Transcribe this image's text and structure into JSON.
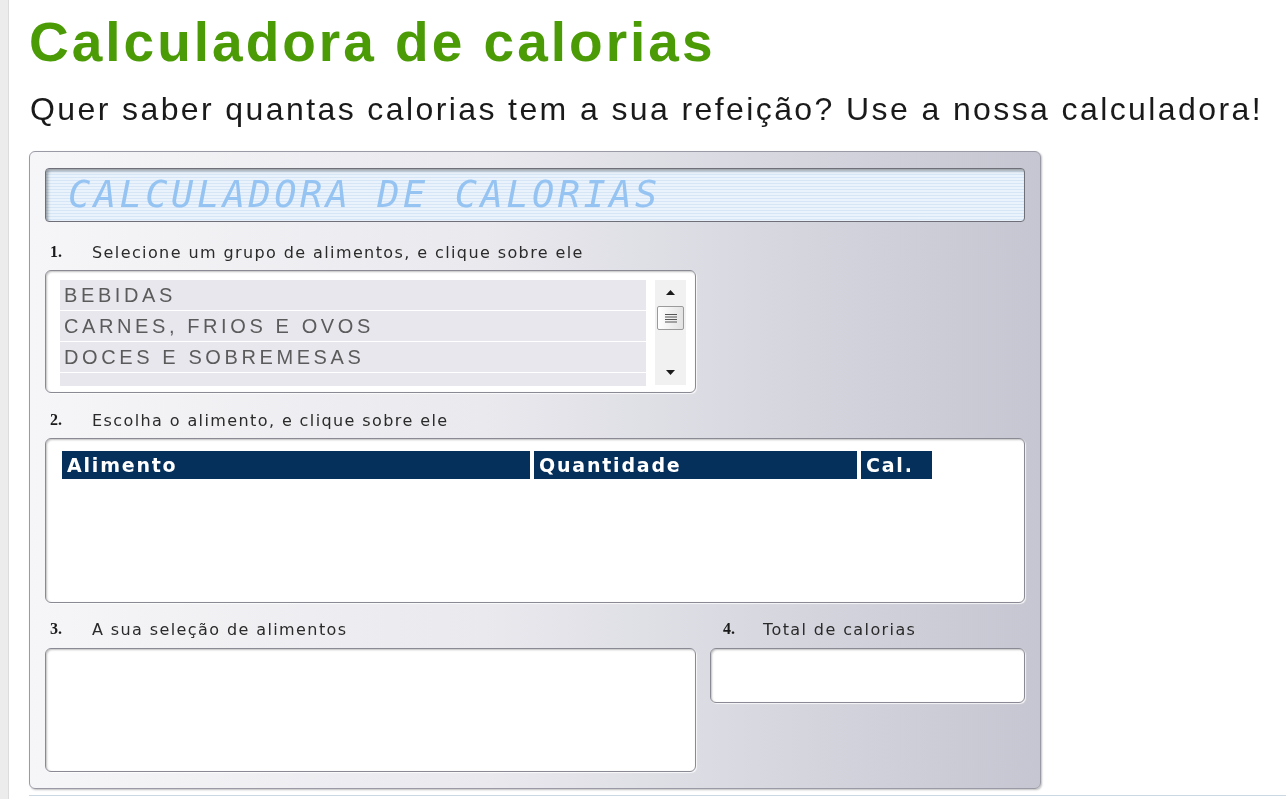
{
  "page": {
    "title": "Calculadora de calorias",
    "subtitle": "Quer saber quantas calorias tem a sua refeição? Use a nossa calculadora!"
  },
  "calculator": {
    "display": "CALCULADORA DE CALORIAS",
    "food_groups": {
      "number": "1.",
      "label": "Selecione um grupo de alimentos, e clique sobre ele",
      "items": [
        {
          "label": "BEBIDAS",
          "selected": false
        },
        {
          "label": "CARNES, FRIOS E OVOS",
          "selected": false
        },
        {
          "label": "DOCES E SOBREMESAS",
          "selected": false
        },
        {
          "selected": false
        }
      ]
    },
    "foods": {
      "number": "2.",
      "label": "Escolha o alimento, e clique sobre ele",
      "columns": [
        "Alimento",
        "Quantidade",
        "Cal."
      ]
    },
    "selection": {
      "number": "3.",
      "label": "A sua seleção de alimentos"
    },
    "total": {
      "number": "4.",
      "label": "Total de calorias"
    }
  }
}
